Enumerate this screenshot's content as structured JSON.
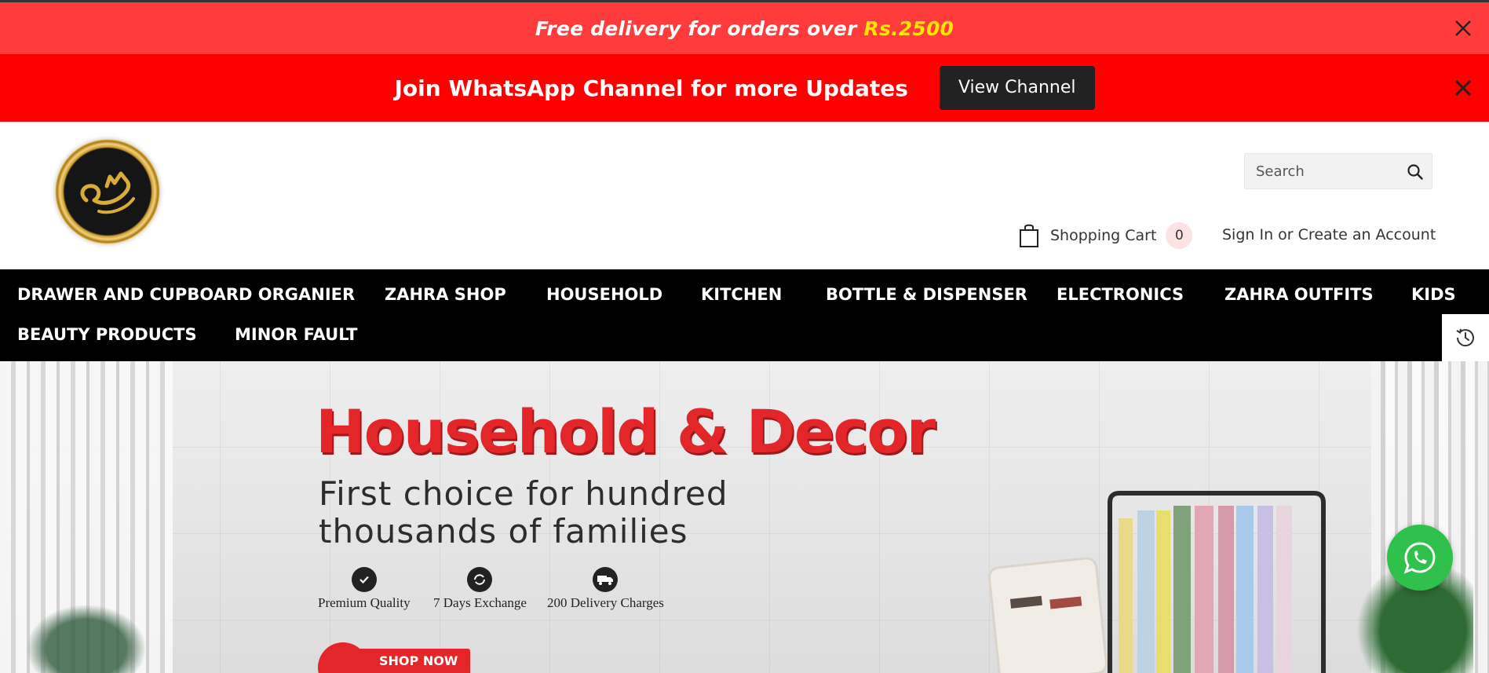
{
  "announcement_bar": {
    "text": "Free delivery for orders over ",
    "amount": "Rs.2500",
    "close_label": "×"
  },
  "whatsapp_bar": {
    "text": "Join WhatsApp Channel for more Updates",
    "button_label": "View Channel"
  },
  "header": {
    "search": {
      "placeholder": "Search"
    },
    "cart": {
      "label": "Shopping Cart",
      "count": "0"
    },
    "account": {
      "sign_in": "Sign In",
      "or": " or ",
      "create": "Create an Account"
    }
  },
  "nav": {
    "items": [
      "DRAWER AND CUPBOARD ORGANIER",
      "ZAHRA SHOP",
      "HOUSEHOLD",
      "KITCHEN",
      "BOTTLE & DISPENSER",
      "ELECTRONICS",
      "ZAHRA OUTFITS",
      "KIDS",
      "BEAUTY PRODUCTS",
      "MINOR FAULT"
    ]
  },
  "hero": {
    "title": "Household & Decor",
    "subtitle_line1": "First choice for hundred",
    "subtitle_line2": "thousands of families",
    "features": [
      {
        "label": "Premium Quality",
        "icon": "badge-icon"
      },
      {
        "label": "7 Days Exchange",
        "icon": "exchange-icon"
      },
      {
        "label": "200 Delivery Charges",
        "icon": "delivery-truck-icon"
      }
    ],
    "cta": "SHOP NOW"
  },
  "colors": {
    "announcement_bg": "#ff3b3b",
    "whatsapp_bar_bg": "#ff0000",
    "nav_bg": "#000000",
    "hero_title": "#e3262a",
    "whatsapp_green": "#2fc14b"
  }
}
